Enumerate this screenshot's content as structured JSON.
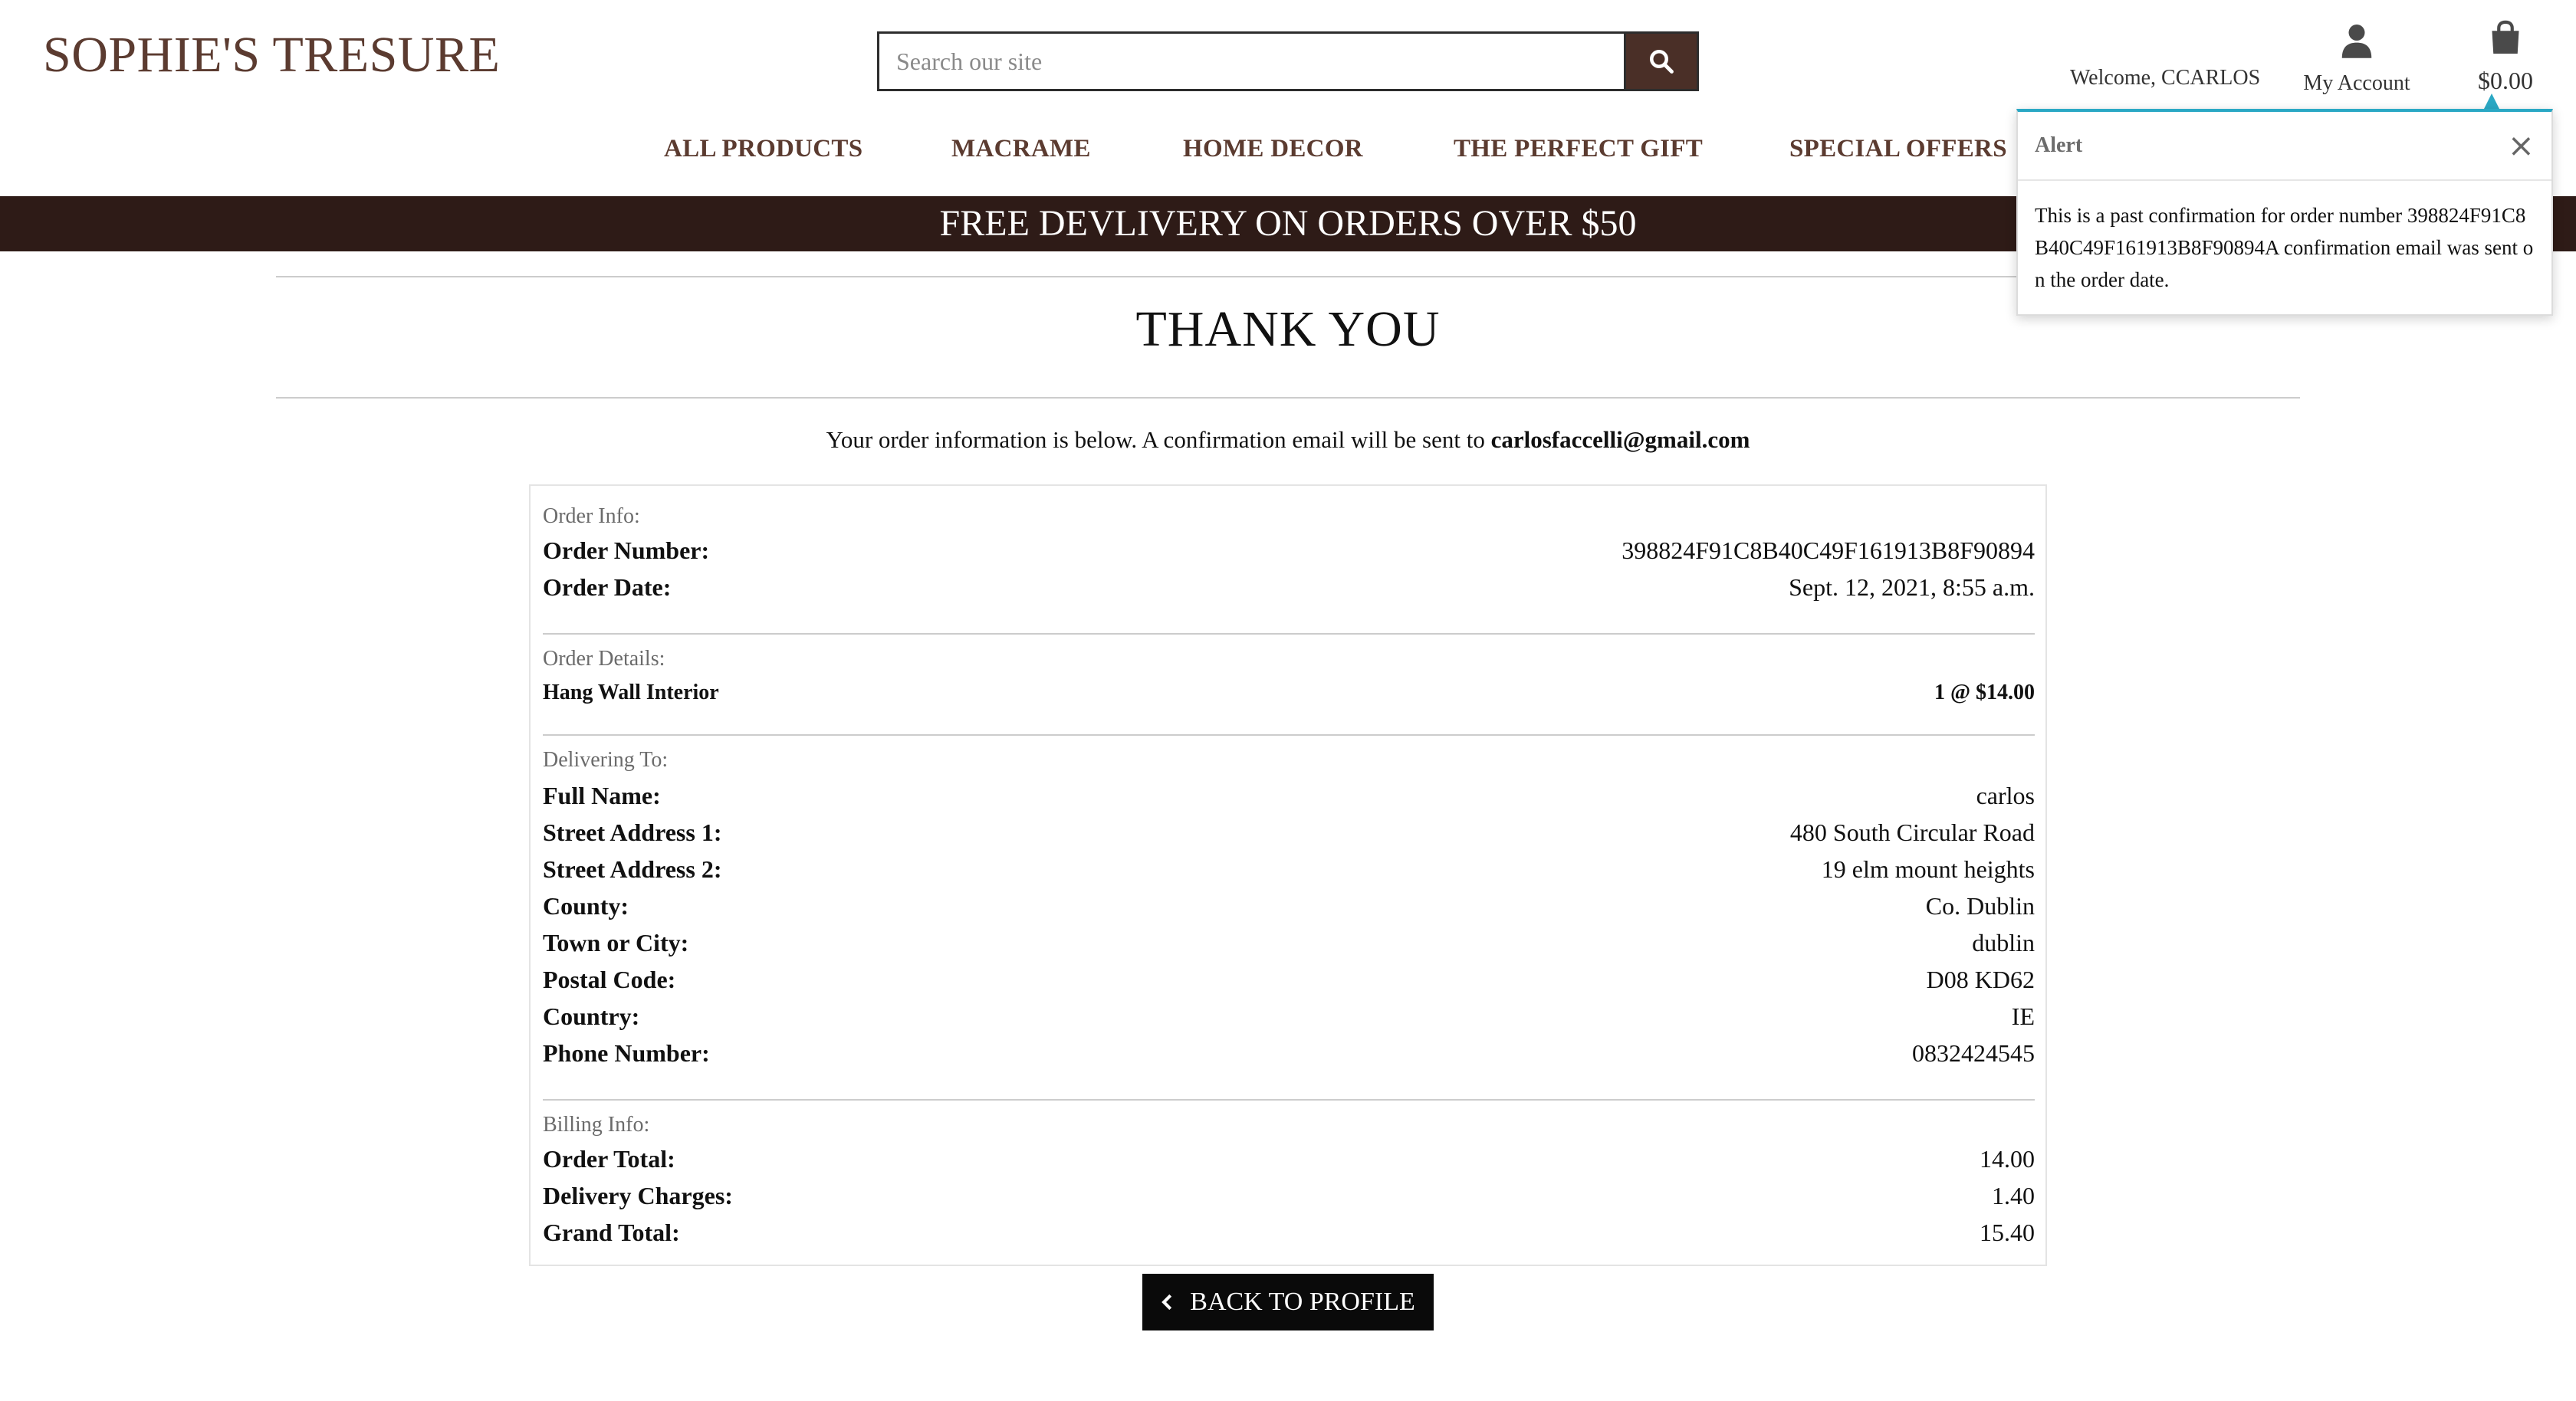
{
  "header": {
    "logo": "SOPHIE'S TRESURE",
    "search_placeholder": "Search our site",
    "welcome": "Welcome, CCARLOS",
    "account_label": "My Account",
    "bag_total": "$0.00"
  },
  "nav": {
    "items": [
      "ALL PRODUCTS",
      "MACRAME",
      "HOME DECOR",
      "THE PERFECT GIFT",
      "SPECIAL OFFERS"
    ]
  },
  "banner": "FREE DEVLIVERY ON ORDERS OVER $50",
  "page": {
    "title": "THANK YOU",
    "intro": "Your order information is below. A confirmation email will be sent to",
    "email": "carlosfaccelli@gmail.com"
  },
  "order_info": {
    "label": "Order Info:",
    "number_key": "Order Number:",
    "number": "398824F91C8B40C49F161913B8F90894",
    "date_key": "Order Date:",
    "date": "Sept. 12, 2021, 8:55 a.m."
  },
  "order_details": {
    "label": "Order Details:",
    "item": "Hang Wall Interior",
    "qty_price": "1 @ $14.00"
  },
  "delivery": {
    "label": "Delivering To:",
    "rows": [
      {
        "key": "Full Name:",
        "value": "carlos"
      },
      {
        "key": "Street Address 1:",
        "value": "480 South Circular Road"
      },
      {
        "key": "Street Address 2:",
        "value": "19 elm mount heights"
      },
      {
        "key": "County:",
        "value": "Co. Dublin"
      },
      {
        "key": "Town or City:",
        "value": "dublin"
      },
      {
        "key": "Postal Code:",
        "value": "D08 KD62"
      },
      {
        "key": "Country:",
        "value": "IE"
      },
      {
        "key": "Phone Number:",
        "value": "0832424545"
      }
    ]
  },
  "billing": {
    "label": "Billing Info:",
    "rows": [
      {
        "key": "Order Total:",
        "value": "14.00"
      },
      {
        "key": "Delivery Charges:",
        "value": "1.40"
      },
      {
        "key": "Grand Total:",
        "value": "15.40"
      }
    ]
  },
  "back_button": "BACK TO PROFILE",
  "alert": {
    "title": "Alert",
    "close": "×",
    "message": "This is a past confirmation for order number 398824F91C8B40C49F161913B8F90894A confirmation email was sent on the order date."
  },
  "colors": {
    "brand": "#5b3b30",
    "banner": "#2e1b17",
    "alert_accent": "#2aa8c4"
  }
}
